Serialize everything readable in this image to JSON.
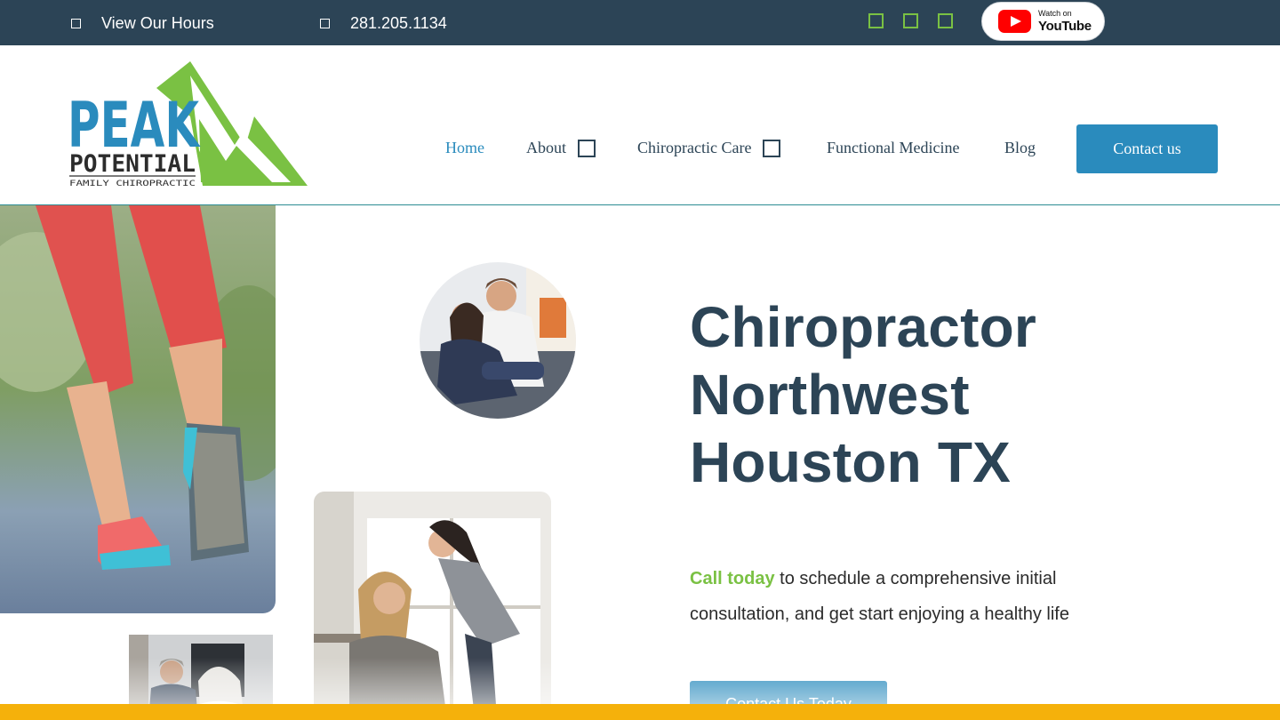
{
  "topbar": {
    "hours_label": "View Our Hours",
    "phone": "281.205.1134",
    "social_icons": [
      "facebook-icon",
      "instagram-icon",
      "twitter-icon"
    ],
    "youtube": {
      "small": "Watch on",
      "big": "YouTube"
    }
  },
  "header": {
    "logo": {
      "word1": "PEAK",
      "word2": "POTENTIAL",
      "tagline": "FAMILY CHIROPRACTIC"
    },
    "nav": {
      "home": "Home",
      "about": "About",
      "chiropractic_care": "Chiropractic Care",
      "functional_medicine": "Functional Medicine",
      "blog": "Blog"
    },
    "contact_button": "Contact us"
  },
  "hero": {
    "title_lines": [
      "Chiropractor",
      "Northwest",
      "Houston TX"
    ],
    "call_today": "Call today",
    "body": " to schedule a comprehensive initial consultation, and get start enjoying a healthy life",
    "cta": "Contact Us Today"
  },
  "colors": {
    "navy": "#2c4456",
    "brand_blue": "#2a8bbd",
    "brand_green": "#7ac143",
    "accent_yellow": "#f5b10b"
  }
}
